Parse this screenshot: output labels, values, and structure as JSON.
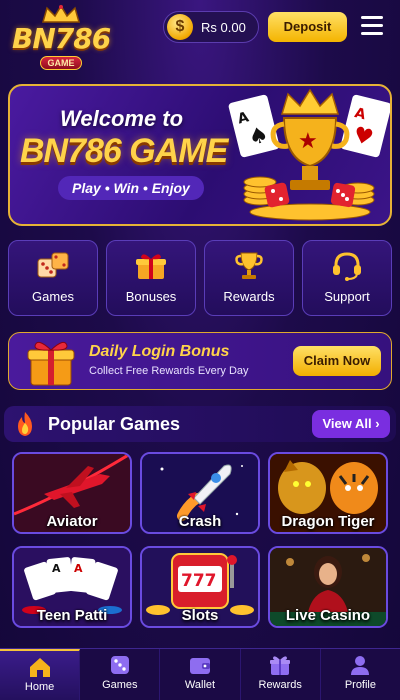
{
  "header": {
    "logo_text": "BN786",
    "logo_sub": "GAME",
    "balance": "Rs 0.00",
    "coin_symbol": "$",
    "deposit_label": "Deposit"
  },
  "hero": {
    "welcome": "Welcome to",
    "brand": "BN786 GAME",
    "tagline": "Play • Win • Enjoy"
  },
  "categories": [
    {
      "label": "Games",
      "icon": "dice-icon"
    },
    {
      "label": "Bonuses",
      "icon": "gift-icon"
    },
    {
      "label": "Rewards",
      "icon": "trophy-icon"
    },
    {
      "label": "Support",
      "icon": "headset-icon"
    }
  ],
  "bonus": {
    "title": "Daily Login Bonus",
    "subtitle": "Collect Free Rewards Every Day",
    "button": "Claim Now"
  },
  "popular": {
    "title": "Popular Games",
    "view_all": "View All"
  },
  "games": [
    {
      "name": "Aviator"
    },
    {
      "name": "Crash"
    },
    {
      "name": "Dragon Tiger"
    },
    {
      "name": "Teen Patti"
    },
    {
      "name": "Slots"
    },
    {
      "name": "Live Casino"
    }
  ],
  "nav": [
    {
      "label": "Home",
      "icon": "home-icon"
    },
    {
      "label": "Games",
      "icon": "dice-icon"
    },
    {
      "label": "Wallet",
      "icon": "wallet-icon"
    },
    {
      "label": "Rewards",
      "icon": "gift-icon"
    },
    {
      "label": "Profile",
      "icon": "user-icon"
    }
  ],
  "colors": {
    "accent_gold": "#f4b400",
    "background": "#1d0b4a",
    "tile_border": "#6a4be0"
  }
}
